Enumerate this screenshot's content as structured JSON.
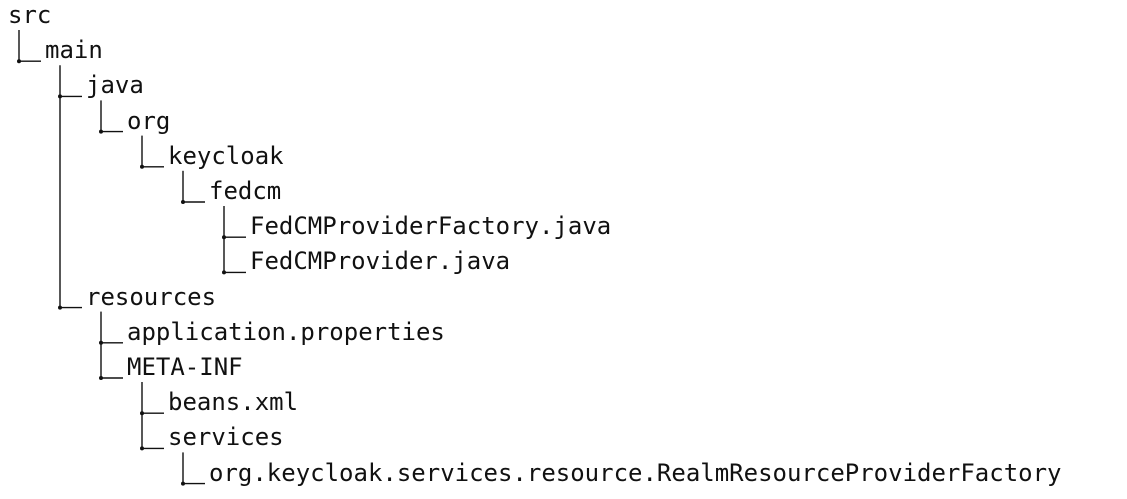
{
  "tree": {
    "nodes": [
      {
        "id": "src",
        "label": "src",
        "depth": 0,
        "parent": null
      },
      {
        "id": "main",
        "label": "main",
        "depth": 1,
        "parent": "src"
      },
      {
        "id": "java",
        "label": "java",
        "depth": 2,
        "parent": "main"
      },
      {
        "id": "org",
        "label": "org",
        "depth": 3,
        "parent": "java"
      },
      {
        "id": "keycloak",
        "label": "keycloak",
        "depth": 4,
        "parent": "org"
      },
      {
        "id": "fedcm",
        "label": "fedcm",
        "depth": 5,
        "parent": "keycloak"
      },
      {
        "id": "fedcm-provider-factory",
        "label": "FedCMProviderFactory.java",
        "depth": 6,
        "parent": "fedcm"
      },
      {
        "id": "fedcm-provider",
        "label": "FedCMProvider.java",
        "depth": 6,
        "parent": "fedcm"
      },
      {
        "id": "resources",
        "label": "resources",
        "depth": 2,
        "parent": "main"
      },
      {
        "id": "application-properties",
        "label": "application.properties",
        "depth": 3,
        "parent": "resources"
      },
      {
        "id": "meta-inf",
        "label": "META-INF",
        "depth": 3,
        "parent": "resources"
      },
      {
        "id": "beans-xml",
        "label": "beans.xml",
        "depth": 4,
        "parent": "meta-inf"
      },
      {
        "id": "services",
        "label": "services",
        "depth": 4,
        "parent": "meta-inf"
      },
      {
        "id": "realm-resource-provider-factory",
        "label": "org.keycloak.services.resource.RealmResourceProviderFactory",
        "depth": 5,
        "parent": "services"
      }
    ]
  }
}
